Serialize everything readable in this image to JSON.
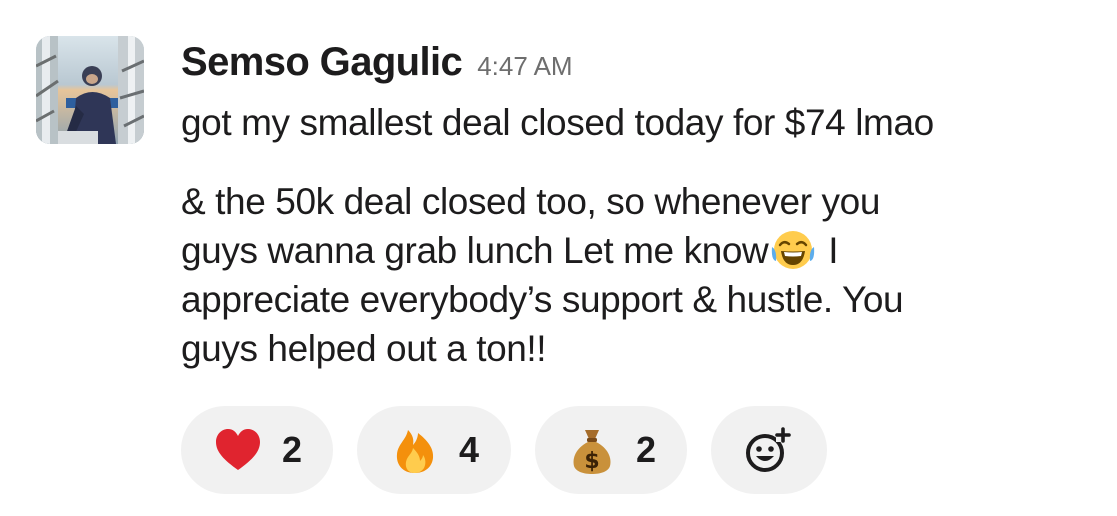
{
  "message": {
    "sender": "Semso Gagulic",
    "timestamp": "4:47 AM",
    "paragraph1": "got my smallest deal closed today for $74 lmao",
    "paragraph2": {
      "line1": "& the 50k deal closed too, so whenever you",
      "line2_before": "guys wanna grab lunch Let me know",
      "line2_after": " I",
      "line3": "appreciate everybody’s support & hustle. You",
      "line4": "guys helped out a ton!!"
    },
    "inline_emoji": "tears-of-joy-emoji"
  },
  "reactions": [
    {
      "emoji": "red-heart",
      "count": "2"
    },
    {
      "emoji": "fire",
      "count": "4"
    },
    {
      "emoji": "money-bag",
      "count": "2"
    }
  ],
  "add_reaction": {
    "icon": "add-reaction-icon"
  },
  "colors": {
    "text": "#1d1c1d",
    "timestamp": "#6e6e6e",
    "reaction_bg": "#f1f1f1",
    "heart": "#e0242f",
    "fire": "#f4900c",
    "money_bag": "#c9913b"
  }
}
